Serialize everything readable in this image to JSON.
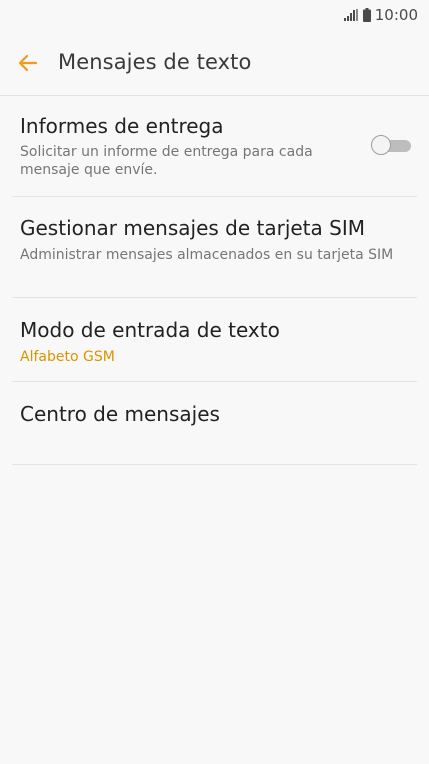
{
  "status_bar": {
    "time": "10:00",
    "icons": [
      "signal-icon",
      "battery-icon"
    ]
  },
  "app_bar": {
    "back_icon": "arrow-left-icon",
    "title": "Mensajes de texto",
    "accent_color": "#f09b1b"
  },
  "settings": [
    {
      "title": "Informes de entrega",
      "subtitle": "Solicitar un informe de entrega para cada mensaje que envíe.",
      "toggle_on": false
    },
    {
      "title": "Gestionar mensajes de tarjeta SIM",
      "subtitle": "Administrar mensajes almacenados en su tarjeta SIM"
    },
    {
      "title": "Modo de entrada de texto",
      "subtitle": "Alfabeto GSM",
      "subtitle_color": "#d99400"
    },
    {
      "title": "Centro de mensajes"
    }
  ]
}
